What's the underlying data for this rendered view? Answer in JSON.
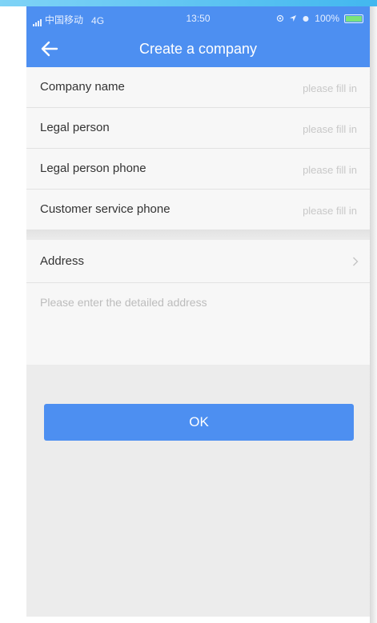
{
  "status_bar": {
    "carrier": "中国移动",
    "network": "4G",
    "time": "13:50",
    "battery": "100%"
  },
  "nav": {
    "back_icon": "back-arrow-icon",
    "title": "Create a company"
  },
  "form": {
    "fields": [
      {
        "label": "Company name",
        "placeholder": "please fill in",
        "value": ""
      },
      {
        "label": "Legal person",
        "placeholder": "please fill in",
        "value": ""
      },
      {
        "label": "Legal person phone",
        "placeholder": "please fill in",
        "value": ""
      },
      {
        "label": "Customer service phone",
        "placeholder": "please fill in",
        "value": ""
      }
    ],
    "address": {
      "label": "Address",
      "chevron_icon": "chevron-right-icon"
    },
    "detail_address": {
      "placeholder": "Please enter the detailed address",
      "value": ""
    }
  },
  "actions": {
    "ok_label": "OK"
  },
  "colors": {
    "primary": "#4d8ff1",
    "background": "#ececec",
    "row_background": "#f7f7f7",
    "placeholder": "#c8c8c8"
  }
}
